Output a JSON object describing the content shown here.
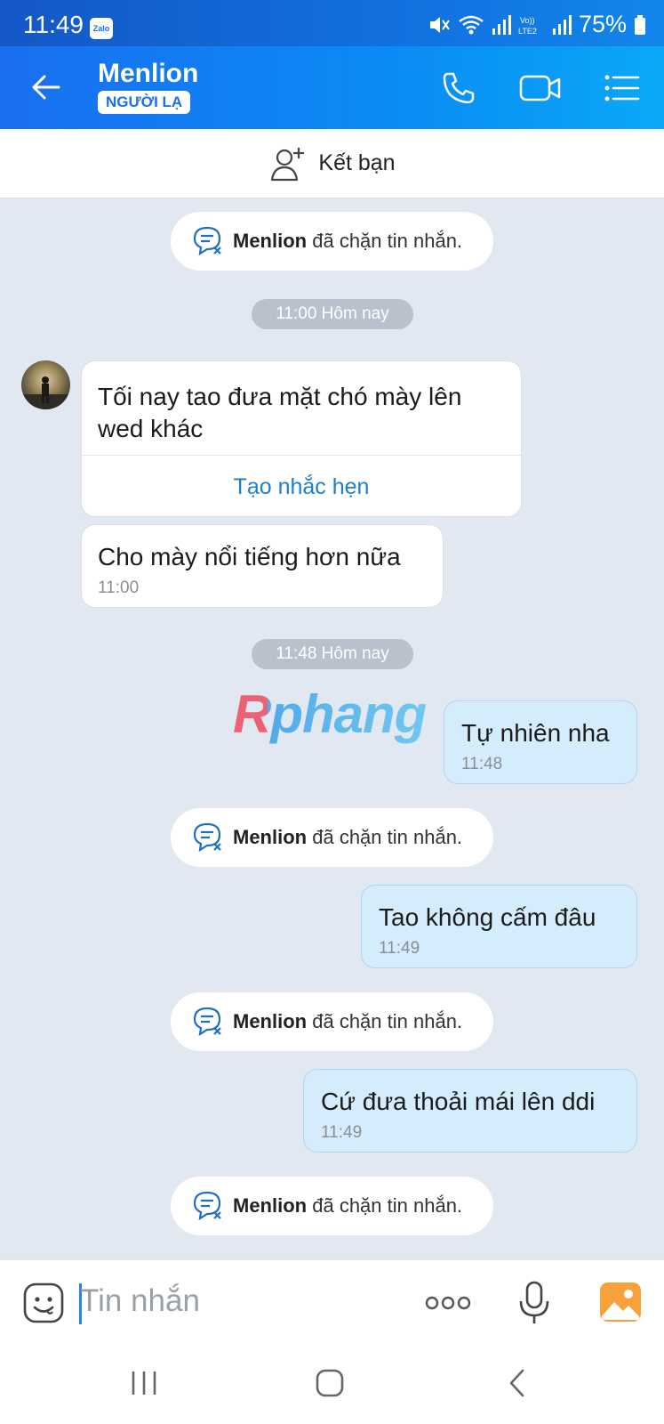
{
  "status_bar": {
    "time": "11:49",
    "app_badge": "Zalo",
    "battery": "75%"
  },
  "header": {
    "contact_name": "Menlion",
    "badge": "NGƯỜI LẠ"
  },
  "add_friend": {
    "label": "Kết bạn"
  },
  "messages": {
    "blocked_1": {
      "name": "Menlion",
      "text": "đã chặn tin nhắn."
    },
    "time_divider_1": "11:00 Hôm nay",
    "in_1": {
      "text_line1": "Tối nay tao đưa mặt chó mày lên",
      "text_line2": "wed khác",
      "reminder": "Tạo nhắc hẹn"
    },
    "in_2": {
      "text": "Cho mày nổi tiếng hơn nữa",
      "time": "11:00"
    },
    "time_divider_2": "11:48 Hôm nay",
    "out_1": {
      "text": "Tự nhiên nha",
      "time": "11:48"
    },
    "blocked_2": {
      "name": "Menlion",
      "text": "đã chặn tin nhắn."
    },
    "out_2": {
      "text": "Tao không cấm đâu",
      "time": "11:49"
    },
    "blocked_3": {
      "name": "Menlion",
      "text": "đã chặn tin nhắn."
    },
    "out_3": {
      "text": "Cứ đưa thoải mái lên ddi",
      "time": "11:49"
    },
    "blocked_4": {
      "name": "Menlion",
      "text": "đã chặn tin nhắn."
    }
  },
  "watermark": "Rphang",
  "input": {
    "placeholder": "Tin nhắn"
  },
  "colors": {
    "header_start": "#1a6ff0",
    "header_end": "#0aa8f7",
    "outgoing_bubble": "#d4ecfb",
    "chat_bg": "#e2e8f1"
  }
}
